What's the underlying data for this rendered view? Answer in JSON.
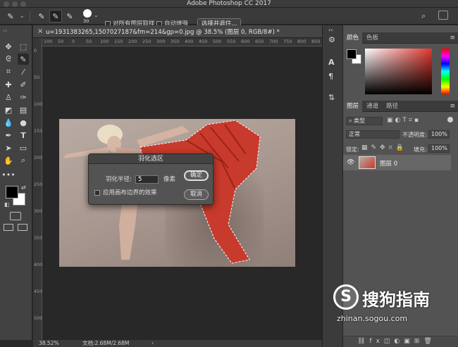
{
  "app": {
    "title": "Adobe Photoshop CC 2017"
  },
  "options": {
    "brush_size": "30",
    "sample_all_layers": "对所有图层取样",
    "auto_enhance": "自动增强",
    "select_and_mask": "选择并遮住..."
  },
  "document": {
    "close_glyph": "×",
    "tab_name": "u=1931383265,1507027187&fm=214&gp=0.jpg @ 38.5% (图层 0, RGB/8#) *"
  },
  "ruler": {
    "top": [
      "100",
      "50",
      "0",
      "50",
      "100",
      "150",
      "200",
      "250",
      "300",
      "350",
      "400",
      "450",
      "500",
      "550",
      "600",
      "650",
      "700",
      "750",
      "800",
      "850",
      "900"
    ],
    "left": [
      "0",
      "50",
      "100",
      "150",
      "200",
      "250",
      "300",
      "350",
      "400",
      "450",
      "500"
    ]
  },
  "dialog": {
    "title": "羽化选区",
    "radius_label": "羽化半径:",
    "radius_value": "5",
    "unit": "像素",
    "ok": "确定",
    "cancel": "取消",
    "apply_canvas_bounds": "应用画布边界的效果"
  },
  "status": {
    "zoom": "38.52%",
    "doc_size": "文档:2.68M/2.68M"
  },
  "color_panel": {
    "tabs": [
      "颜色",
      "色板"
    ],
    "foreground": "#000000",
    "background": "#ffffff"
  },
  "layers_panel": {
    "tabs": [
      "图层",
      "通道",
      "路径"
    ],
    "filter_kind": "类型",
    "blend_mode": "正常",
    "opacity_label": "不透明度:",
    "opacity_value": "100%",
    "lock_label": "锁定:",
    "fill_label": "填充:",
    "fill_value": "100%",
    "layer_name": "图层 0"
  },
  "watermark": {
    "brand": "搜狗指南",
    "url": "zhinan.sogou.com"
  }
}
